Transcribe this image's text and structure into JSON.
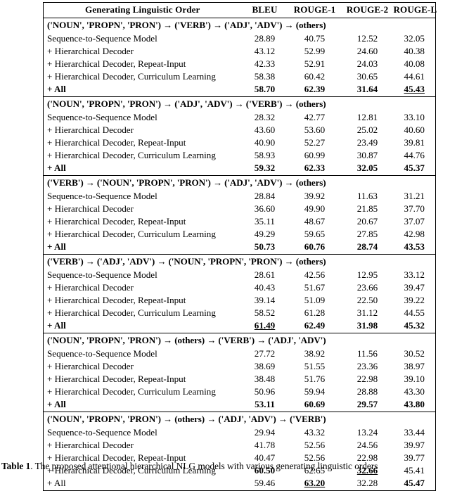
{
  "table": {
    "columns": [
      "Generating Linguistic Order",
      "BLEU",
      "ROUGE-1",
      "ROUGE-2",
      "ROUGE-L"
    ],
    "row_labels": [
      "Sequence-to-Sequence Model",
      "+ Hierarchical Decoder",
      "+ Hierarchical Decoder, Repeat-Input",
      "+ Hierarchical Decoder, Curriculum Learning",
      "+ All"
    ],
    "groups": [
      {
        "order": "('NOUN', 'PROPN', 'PRON') → ('VERB') → ('ADJ', 'ADV') → (others)",
        "rows": [
          {
            "label": "Sequence-to-Sequence Model",
            "bleu": "28.89",
            "rouge1": "40.75",
            "rouge2": "12.52",
            "rougel": "32.05",
            "bold": false,
            "underline": []
          },
          {
            "label": "+ Hierarchical Decoder",
            "bleu": "43.12",
            "rouge1": "52.99",
            "rouge2": "24.60",
            "rougel": "40.38",
            "bold": false,
            "underline": []
          },
          {
            "label": "+ Hierarchical Decoder, Repeat-Input",
            "bleu": "42.33",
            "rouge1": "52.91",
            "rouge2": "24.03",
            "rougel": "40.08",
            "bold": false,
            "underline": []
          },
          {
            "label": "+ Hierarchical Decoder, Curriculum Learning",
            "bleu": "58.38",
            "rouge1": "60.42",
            "rouge2": "30.65",
            "rougel": "44.61",
            "bold": false,
            "underline": []
          },
          {
            "label": "+ All",
            "bleu": "58.70",
            "rouge1": "62.39",
            "rouge2": "31.64",
            "rougel": "45.43",
            "bold": true,
            "underline": [
              "rougel"
            ]
          }
        ]
      },
      {
        "order": "('NOUN', 'PROPN', 'PRON') → ('ADJ', 'ADV') → ('VERB') → (others)",
        "rows": [
          {
            "label": "Sequence-to-Sequence Model",
            "bleu": "28.32",
            "rouge1": "42.77",
            "rouge2": "12.81",
            "rougel": "33.10",
            "bold": false,
            "underline": []
          },
          {
            "label": "+ Hierarchical Decoder",
            "bleu": "43.60",
            "rouge1": "53.60",
            "rouge2": "25.02",
            "rougel": "40.60",
            "bold": false,
            "underline": []
          },
          {
            "label": "+ Hierarchical Decoder, Repeat-Input",
            "bleu": "40.90",
            "rouge1": "52.27",
            "rouge2": "23.49",
            "rougel": "39.81",
            "bold": false,
            "underline": []
          },
          {
            "label": "+ Hierarchical Decoder, Curriculum Learning",
            "bleu": "58.93",
            "rouge1": "60.99",
            "rouge2": "30.87",
            "rougel": "44.76",
            "bold": false,
            "underline": []
          },
          {
            "label": "+ All",
            "bleu": "59.32",
            "rouge1": "62.33",
            "rouge2": "32.05",
            "rougel": "45.37",
            "bold": true,
            "underline": []
          }
        ]
      },
      {
        "order": "('VERB') → ('NOUN', 'PROPN', 'PRON') → ('ADJ', 'ADV') → (others)",
        "rows": [
          {
            "label": "Sequence-to-Sequence Model",
            "bleu": "28.84",
            "rouge1": "39.92",
            "rouge2": "11.63",
            "rougel": "31.21",
            "bold": false,
            "underline": []
          },
          {
            "label": "+ Hierarchical Decoder",
            "bleu": "36.60",
            "rouge1": "49.90",
            "rouge2": "21.85",
            "rougel": "37.70",
            "bold": false,
            "underline": []
          },
          {
            "label": "+ Hierarchical Decoder, Repeat-Input",
            "bleu": "35.11",
            "rouge1": "48.67",
            "rouge2": "20.67",
            "rougel": "37.07",
            "bold": false,
            "underline": []
          },
          {
            "label": "+ Hierarchical Decoder, Curriculum Learning",
            "bleu": "49.29",
            "rouge1": "59.65",
            "rouge2": "27.85",
            "rougel": "42.98",
            "bold": false,
            "underline": []
          },
          {
            "label": "+ All",
            "bleu": "50.73",
            "rouge1": "60.76",
            "rouge2": "28.74",
            "rougel": "43.53",
            "bold": true,
            "underline": []
          }
        ]
      },
      {
        "order": "('VERB') → ('ADJ', 'ADV') → ('NOUN', 'PROPN', 'PRON') → (others)",
        "rows": [
          {
            "label": "Sequence-to-Sequence Model",
            "bleu": "28.61",
            "rouge1": "42.56",
            "rouge2": "12.95",
            "rougel": "33.12",
            "bold": false,
            "underline": []
          },
          {
            "label": "+ Hierarchical Decoder",
            "bleu": "40.43",
            "rouge1": "51.67",
            "rouge2": "23.66",
            "rougel": "39.47",
            "bold": false,
            "underline": []
          },
          {
            "label": "+ Hierarchical Decoder, Repeat-Input",
            "bleu": "39.14",
            "rouge1": "51.09",
            "rouge2": "22.50",
            "rougel": "39.22",
            "bold": false,
            "underline": []
          },
          {
            "label": "+ Hierarchical Decoder, Curriculum Learning",
            "bleu": "58.52",
            "rouge1": "61.28",
            "rouge2": "31.12",
            "rougel": "44.55",
            "bold": false,
            "underline": []
          },
          {
            "label": "+ All",
            "bleu": "61.49",
            "rouge1": "62.49",
            "rouge2": "31.98",
            "rougel": "45.32",
            "bold": true,
            "underline": [
              "bleu"
            ]
          }
        ]
      },
      {
        "order": "('NOUN', 'PROPN', 'PRON') → (others) → ('VERB') → ('ADJ', 'ADV')",
        "rows": [
          {
            "label": "Sequence-to-Sequence Model",
            "bleu": "27.72",
            "rouge1": "38.92",
            "rouge2": "11.56",
            "rougel": "30.52",
            "bold": false,
            "underline": []
          },
          {
            "label": "+ Hierarchical Decoder",
            "bleu": "38.69",
            "rouge1": "51.55",
            "rouge2": "23.36",
            "rougel": "38.97",
            "bold": false,
            "underline": []
          },
          {
            "label": "+ Hierarchical Decoder, Repeat-Input",
            "bleu": "38.48",
            "rouge1": "51.76",
            "rouge2": "22.98",
            "rougel": "39.10",
            "bold": false,
            "underline": []
          },
          {
            "label": "+ Hierarchical Decoder, Curriculum Learning",
            "bleu": "50.96",
            "rouge1": "59.94",
            "rouge2": "28.88",
            "rougel": "43.30",
            "bold": false,
            "underline": []
          },
          {
            "label": "+ All",
            "bleu": "53.11",
            "rouge1": "60.69",
            "rouge2": "29.57",
            "rougel": "43.80",
            "bold": true,
            "underline": []
          }
        ]
      },
      {
        "order": "('NOUN', 'PROPN', 'PRON') → (others) → ('ADJ', 'ADV') → ('VERB')",
        "rows": [
          {
            "label": "Sequence-to-Sequence Model",
            "bleu": "29.94",
            "rouge1": "43.32",
            "rouge2": "13.24",
            "rougel": "33.44",
            "bold": false,
            "underline": []
          },
          {
            "label": "+ Hierarchical Decoder",
            "bleu": "41.78",
            "rouge1": "52.56",
            "rouge2": "24.56",
            "rougel": "39.97",
            "bold": false,
            "underline": []
          },
          {
            "label": "+ Hierarchical Decoder, Repeat-Input",
            "bleu": "40.47",
            "rouge1": "52.56",
            "rouge2": "22.98",
            "rougel": "39.77",
            "bold": false,
            "underline": []
          },
          {
            "label": "+ Hierarchical Decoder, Curriculum Learning",
            "bleu": "60.50",
            "rouge1": "62.65",
            "rouge2": "32.66",
            "rougel": "45.41",
            "bold": false,
            "bold_cells": [
              "bleu",
              "rouge2"
            ],
            "underline": [
              "rouge2"
            ]
          },
          {
            "label": "+ All",
            "bleu": "59.46",
            "rouge1": "63.20",
            "rouge2": "32.28",
            "rougel": "45.47",
            "bold": false,
            "bold_cells": [
              "rouge1",
              "rougel"
            ],
            "underline": [
              "rouge1"
            ]
          }
        ]
      }
    ]
  },
  "caption": {
    "number": "Table 1",
    "separator": ". ",
    "text": "The proposed attentional hierarchical NLG models with various generating linguistic orders"
  }
}
